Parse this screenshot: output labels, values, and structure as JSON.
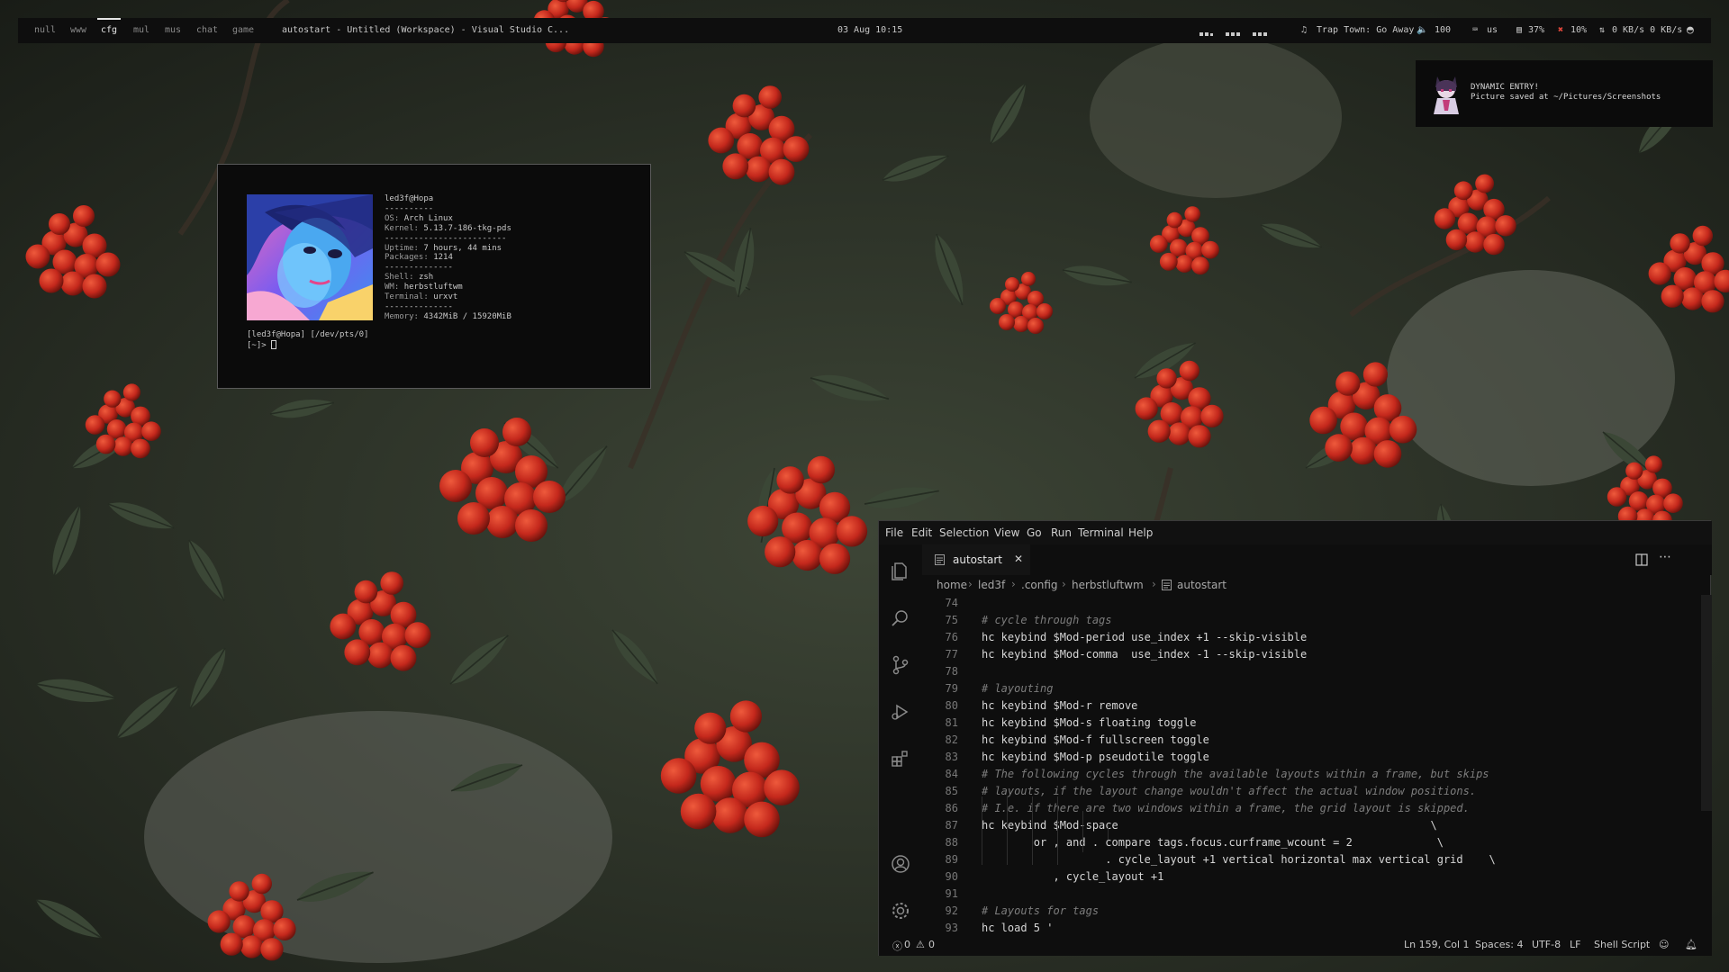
{
  "topbar": {
    "tags": [
      "null",
      "www",
      "cfg",
      "mul",
      "mus",
      "chat",
      "game"
    ],
    "active_tag": "cfg",
    "window_title": "autostart - Untitled (Workspace) - Visual Studio C...",
    "clock": "03 Aug 10:15",
    "now_playing": "Trap Town: Go Away",
    "volume": "100",
    "keyboard_layout": "us",
    "cpu": "37%",
    "ram": "10%",
    "network": "0 KB/s 0 KB/s"
  },
  "notification": {
    "title": "DYNAMIC ENTRY!",
    "body": "Picture saved at ~/Pictures/Screenshots"
  },
  "terminal": {
    "user_host": "led3f@Hopa",
    "divider": "----------",
    "os_key": "OS:",
    "os_val": "Arch Linux",
    "kernel_key": "Kernel:",
    "kernel_val": "5.13.7-186-tkg-pds",
    "divider2": "-------------------------",
    "uptime_key": "Uptime:",
    "uptime_val": "7 hours, 44 mins",
    "packages_key": "Packages:",
    "packages_val": "1214",
    "divider3": "--------------",
    "shell_key": "Shell:",
    "shell_val": "zsh",
    "wm_key": "WM:",
    "wm_val": "herbstluftwm",
    "term_key": "Terminal:",
    "term_val": "urxvt",
    "divider4": "--------------",
    "memory_key": "Memory:",
    "memory_val": "4342MiB / 15920MiB",
    "prompt_line1": "[led3f@Hopa] [/dev/pts/0]",
    "prompt_line2": "[~]>"
  },
  "vscode": {
    "menu": [
      "File",
      "Edit",
      "Selection",
      "View",
      "Go",
      "Run",
      "Terminal",
      "Help"
    ],
    "tab_label": "autostart",
    "breadcrumb": [
      "home",
      "led3f",
      ".config",
      "herbstluftwm",
      "autostart"
    ],
    "lines": [
      {
        "n": "74",
        "text": "",
        "type": "code"
      },
      {
        "n": "75",
        "text": "# cycle through tags",
        "type": "comment"
      },
      {
        "n": "76",
        "text": "hc keybind $Mod-period use_index +1 --skip-visible",
        "type": "code"
      },
      {
        "n": "77",
        "text": "hc keybind $Mod-comma  use_index -1 --skip-visible",
        "type": "code"
      },
      {
        "n": "78",
        "text": "",
        "type": "code"
      },
      {
        "n": "79",
        "text": "# layouting",
        "type": "comment"
      },
      {
        "n": "80",
        "text": "hc keybind $Mod-r remove",
        "type": "code"
      },
      {
        "n": "81",
        "text": "hc keybind $Mod-s floating toggle",
        "type": "code"
      },
      {
        "n": "82",
        "text": "hc keybind $Mod-f fullscreen toggle",
        "type": "code"
      },
      {
        "n": "83",
        "text": "hc keybind $Mod-p pseudotile toggle",
        "type": "code"
      },
      {
        "n": "84",
        "text": "# The following cycles through the available layouts within a frame, but skips",
        "type": "comment"
      },
      {
        "n": "85",
        "text": "# layouts, if the layout change wouldn't affect the actual window positions.",
        "type": "comment"
      },
      {
        "n": "86",
        "text": "# I.e. if there are two windows within a frame, the grid layout is skipped.",
        "type": "comment"
      },
      {
        "n": "87",
        "text": "hc keybind $Mod-space                                                \\",
        "type": "code"
      },
      {
        "n": "88",
        "text": "        or , and . compare tags.focus.curframe_wcount = 2             \\",
        "type": "code"
      },
      {
        "n": "89",
        "text": "                   . cycle_layout +1 vertical horizontal max vertical grid    \\",
        "type": "code"
      },
      {
        "n": "90",
        "text": "           , cycle_layout +1",
        "type": "code"
      },
      {
        "n": "91",
        "text": "",
        "type": "code"
      },
      {
        "n": "92",
        "text": "# Layouts for tags",
        "type": "comment"
      },
      {
        "n": "93",
        "text": "hc load 5 '",
        "type": "code"
      }
    ],
    "status": {
      "errors": "0",
      "warnings": "0",
      "position": "Ln 159, Col 1",
      "spaces": "Spaces: 4",
      "encoding": "UTF-8",
      "eol": "LF",
      "language": "Shell Script"
    }
  },
  "colors": {
    "bar_bg": "#0e0e0e",
    "editor_bg": "#0e0e0e",
    "berry_red": "#c4281c",
    "leaf_green": "#2f3a2b"
  },
  "icons": [
    "speaker-icon",
    "keyboard-icon",
    "cpu-icon",
    "ram-icon",
    "network-icon",
    "music-icon",
    "arch-icon",
    "explorer-icon",
    "search-icon",
    "source-control-icon",
    "run-debug-icon",
    "extensions-icon",
    "account-icon",
    "settings-icon",
    "split-editor-icon",
    "more-icon",
    "error-icon",
    "warning-icon",
    "feedback-icon",
    "bell-icon"
  ]
}
